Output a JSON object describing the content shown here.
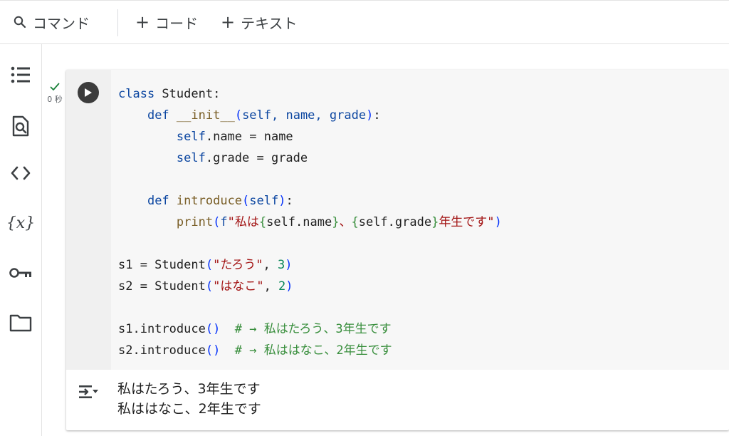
{
  "toolbar": {
    "command_label": "コマンド",
    "code_label": "コード",
    "text_label": "テキスト",
    "plus": "+"
  },
  "rail": {
    "items": [
      "toc-icon",
      "find-icon",
      "code-snippets-icon",
      "variables-icon",
      "secrets-key-icon",
      "files-folder-icon"
    ],
    "variables_label": "{x}"
  },
  "cell": {
    "status_time": "0 秒",
    "code": {
      "l1_kw": "class",
      "l1_rest": " Student:",
      "l2_indent": "    ",
      "l2_kw": "def",
      "l2_fn": "__init__",
      "l2_open": "(",
      "l2_params": "self, name, grade",
      "l2_close": ")",
      "l2_end": ":",
      "l3_indent": "        ",
      "l3_self": "self",
      "l3_rest": ".name = name",
      "l4_self": "self",
      "l4_rest": ".grade = grade",
      "l6_kw": "def",
      "l6_fn": "introduce",
      "l6_open": "(",
      "l6_self": "self",
      "l6_close": ")",
      "l6_end": ":",
      "l7_fn": "print",
      "l7_open": "(",
      "l7_f": "f",
      "l7_s1": "\"私は",
      "l7_b1o": "{",
      "l7_e1": "self.name",
      "l7_b1c": "}",
      "l7_s2": "、",
      "l7_b2o": "{",
      "l7_e2": "self.grade",
      "l7_b2c": "}",
      "l7_s3": "年生です\"",
      "l7_close": ")",
      "l9_pre": "s1 = Student",
      "l9_open": "(",
      "l9_str": "\"たろう\"",
      "l9_comma": ", ",
      "l9_num": "3",
      "l9_close": ")",
      "l10_pre": "s2 = Student",
      "l10_open": "(",
      "l10_str": "\"はなこ\"",
      "l10_comma": ", ",
      "l10_num": "2",
      "l10_close": ")",
      "l12_pre": "s1.introduce",
      "l12_open": "(",
      "l12_close": ")",
      "l12_comment": "  # → 私はたろう、3年生です",
      "l13_pre": "s2.introduce",
      "l13_open": "(",
      "l13_close": ")",
      "l13_comment": "  # → 私ははなこ、2年生です"
    },
    "output": {
      "lines": [
        "私はたろう、3年生です",
        "私ははなこ、2年生です"
      ]
    }
  },
  "colors": {
    "keyword": "#0d47a1",
    "function": "#795e26",
    "paren": "#0431fa",
    "string": "#a31515",
    "comment": "#388e3c",
    "number": "#098658"
  }
}
